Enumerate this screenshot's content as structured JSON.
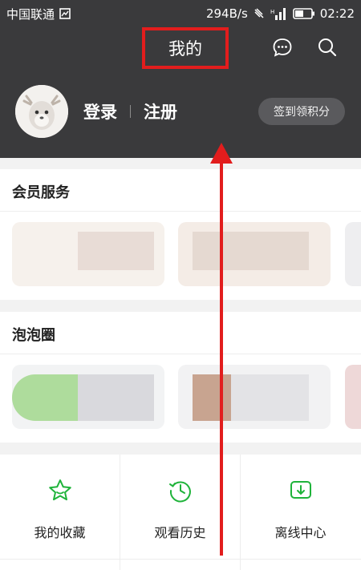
{
  "status_bar": {
    "carrier": "中国联通",
    "net_speed": "294B/s",
    "time": "02:22"
  },
  "header": {
    "title": "我的",
    "login_label": "登录",
    "register_label": "注册",
    "sign_in_button": "签到领积分",
    "icons": [
      "message-icon",
      "search-icon"
    ]
  },
  "sections": {
    "member": {
      "title": "会员服务"
    },
    "bubble": {
      "title": "泡泡圈"
    }
  },
  "quick_actions": [
    {
      "label": "我的收藏",
      "icon": "star-icon"
    },
    {
      "label": "观看历史",
      "icon": "history-clock-icon"
    },
    {
      "label": "离线中心",
      "icon": "download-icon"
    }
  ],
  "colors": {
    "header_bg": "#3a3a3c",
    "accent_green": "#1fb33a",
    "annotation_red": "#e21d1d"
  }
}
